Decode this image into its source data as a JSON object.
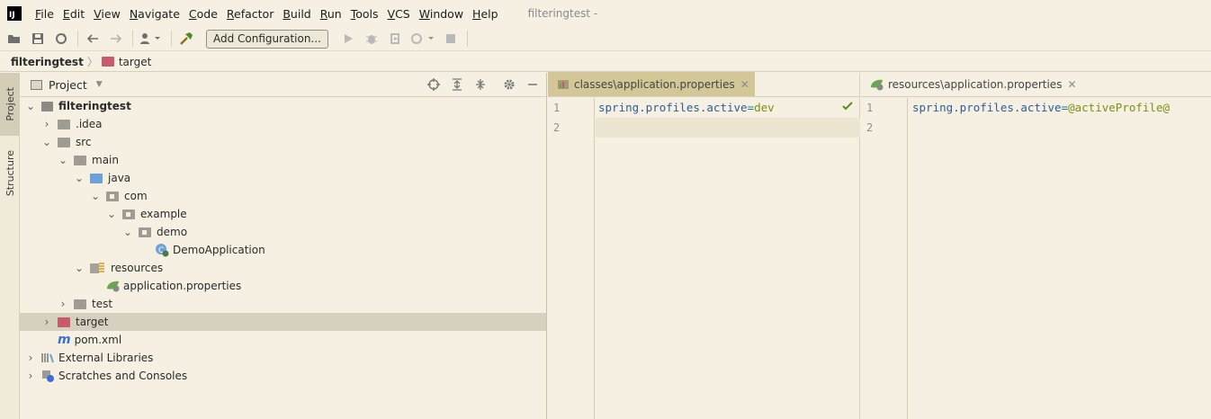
{
  "menubar": {
    "items": [
      "File",
      "Edit",
      "View",
      "Navigate",
      "Code",
      "Refactor",
      "Build",
      "Run",
      "Tools",
      "VCS",
      "Window",
      "Help"
    ],
    "title": "filteringtest -"
  },
  "toolbar": {
    "add_config_label": "Add Configuration..."
  },
  "breadcrumb": {
    "root": "filteringtest",
    "child": "target"
  },
  "tool_strip": {
    "project_tab": "Project",
    "structure_tab": "Structure"
  },
  "project_panel": {
    "title": "Project",
    "tree": [
      {
        "label": "filteringtest",
        "depth": 0
      },
      {
        "label": ".idea",
        "depth": 1
      },
      {
        "label": "src",
        "depth": 1
      },
      {
        "label": "main",
        "depth": 2
      },
      {
        "label": "java",
        "depth": 3
      },
      {
        "label": "com",
        "depth": 4
      },
      {
        "label": "example",
        "depth": 5
      },
      {
        "label": "demo",
        "depth": 6
      },
      {
        "label": "DemoApplication",
        "depth": 7
      },
      {
        "label": "resources",
        "depth": 3
      },
      {
        "label": "application.properties",
        "depth": 4
      },
      {
        "label": "test",
        "depth": 2
      },
      {
        "label": "target",
        "depth": 1
      },
      {
        "label": "pom.xml",
        "depth": 1
      },
      {
        "label": "External Libraries",
        "depth": 0
      },
      {
        "label": "Scratches and Consoles",
        "depth": 0
      }
    ]
  },
  "editor_left": {
    "tab_label": "classes\\application.properties",
    "lines": [
      "1",
      "2"
    ],
    "code": {
      "key": "spring.profiles.active",
      "eq": "=",
      "value": "dev"
    }
  },
  "editor_right": {
    "tab_label": "resources\\application.properties",
    "lines": [
      "1",
      "2"
    ],
    "code": {
      "key": "spring.profiles.active",
      "eq": "=",
      "value": "@activeProfile@"
    }
  }
}
